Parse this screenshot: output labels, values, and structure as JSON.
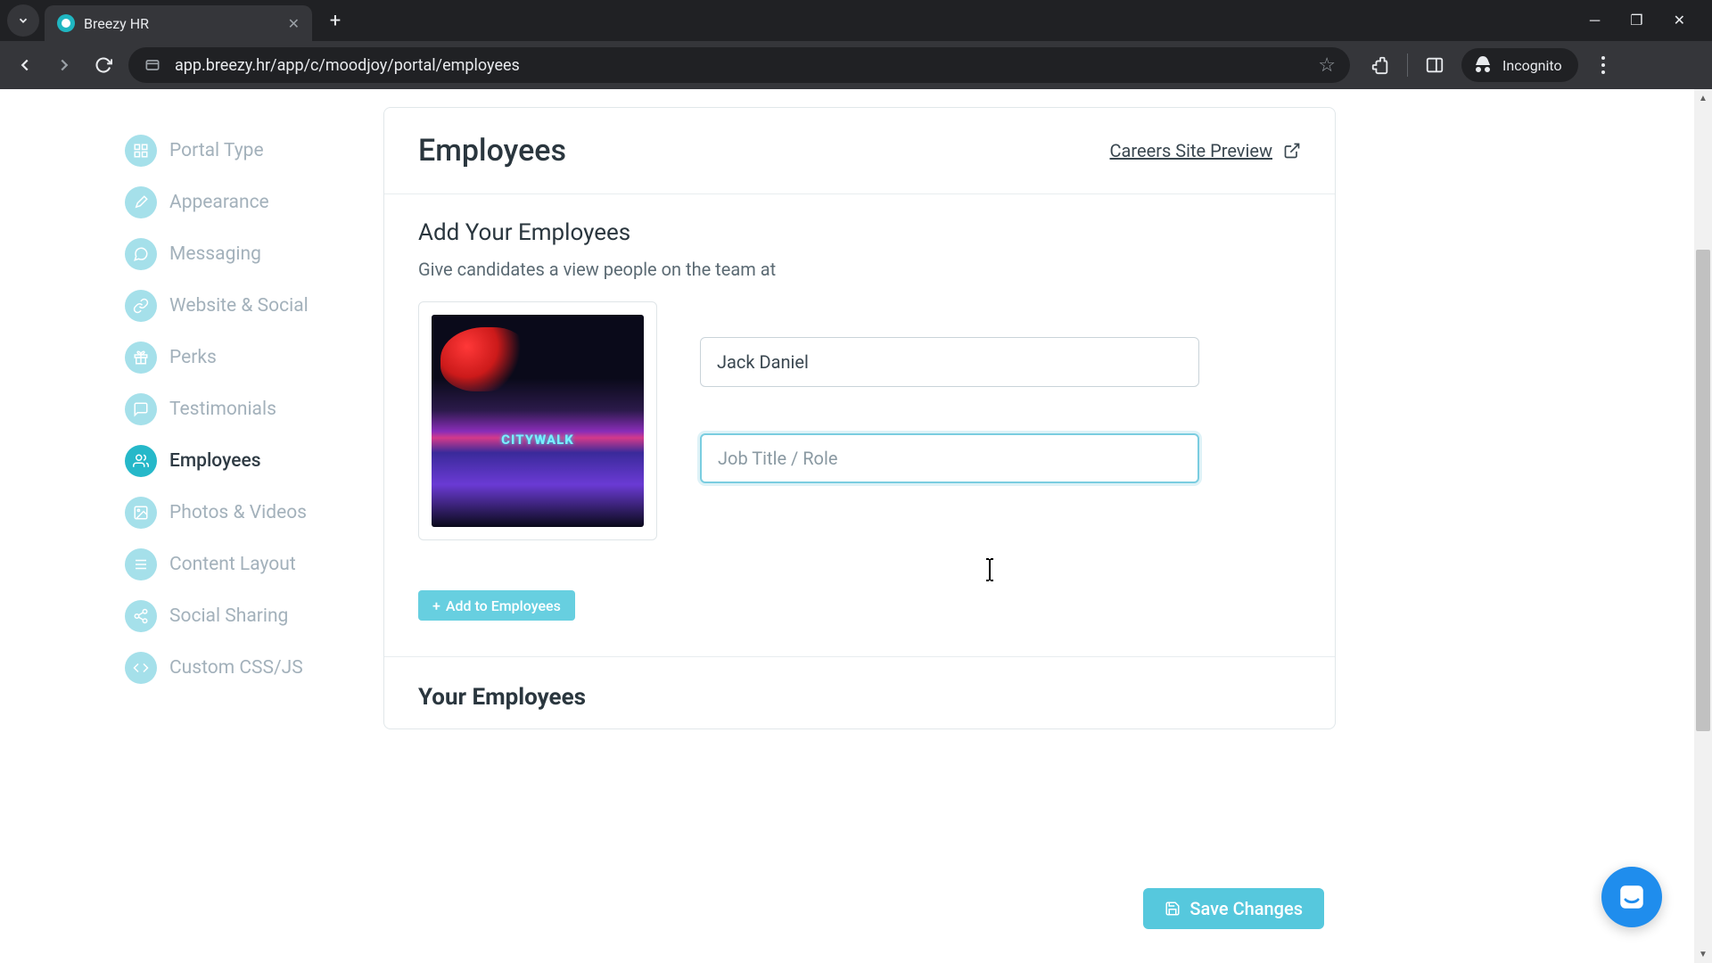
{
  "browser": {
    "tab_title": "Breezy HR",
    "url": "app.breezy.hr/app/c/moodjoy/portal/employees",
    "incognito_label": "Incognito"
  },
  "sidebar": {
    "items": [
      {
        "label": "Portal Type"
      },
      {
        "label": "Appearance"
      },
      {
        "label": "Messaging"
      },
      {
        "label": "Website & Social"
      },
      {
        "label": "Perks"
      },
      {
        "label": "Testimonials"
      },
      {
        "label": "Employees"
      },
      {
        "label": "Photos & Videos"
      },
      {
        "label": "Content Layout"
      },
      {
        "label": "Social Sharing"
      },
      {
        "label": "Custom CSS/JS"
      }
    ],
    "active_index": 6
  },
  "header": {
    "title": "Employees",
    "preview_label": "Careers Site Preview"
  },
  "add_section": {
    "title": "Add Your Employees",
    "subtitle": "Give candidates a view people on the team at",
    "name_value": "Jack Daniel",
    "role_placeholder": "Job Title / Role",
    "role_value": "",
    "add_button_label": "Add to Employees"
  },
  "your_section": {
    "title": "Your Employees"
  },
  "footer": {
    "save_label": "Save Changes"
  }
}
